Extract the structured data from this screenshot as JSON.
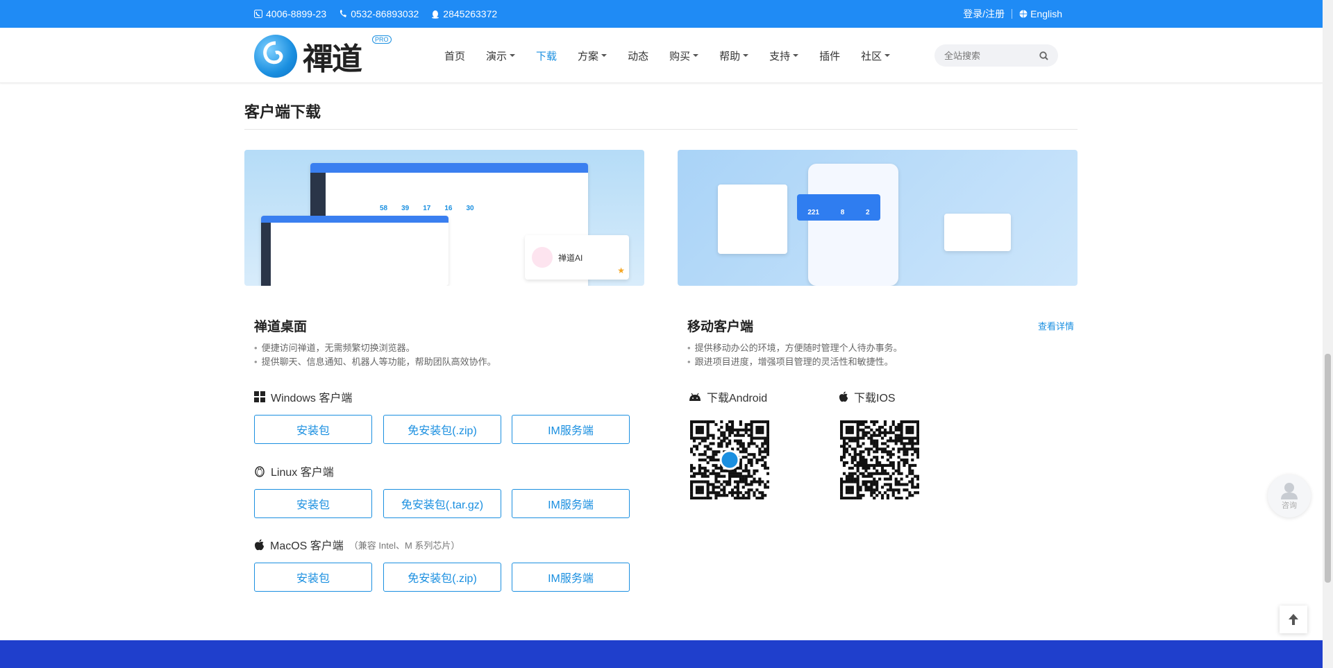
{
  "topbar": {
    "hotline": "4006-8899-23",
    "phone": "0532-86893032",
    "qq": "2845263372",
    "login": "登录/注册",
    "language": "English"
  },
  "brand": {
    "name": "禪道",
    "badge": "PRO"
  },
  "nav": {
    "items": [
      {
        "label": "首页",
        "dropdown": false,
        "active": false
      },
      {
        "label": "演示",
        "dropdown": true,
        "active": false
      },
      {
        "label": "下载",
        "dropdown": false,
        "active": true
      },
      {
        "label": "方案",
        "dropdown": true,
        "active": false
      },
      {
        "label": "动态",
        "dropdown": false,
        "active": false
      },
      {
        "label": "购买",
        "dropdown": true,
        "active": false
      },
      {
        "label": "帮助",
        "dropdown": true,
        "active": false
      },
      {
        "label": "支持",
        "dropdown": true,
        "active": false
      },
      {
        "label": "插件",
        "dropdown": false,
        "active": false
      },
      {
        "label": "社区",
        "dropdown": true,
        "active": false
      }
    ],
    "search_placeholder": "全站搜索"
  },
  "section": {
    "title": "客户端下载"
  },
  "banner_left": {
    "ai_label": "禅道AI",
    "stats": [
      "58",
      "39",
      "17",
      "16",
      "30"
    ]
  },
  "banner_right": {
    "stats": [
      "221",
      "8",
      "2"
    ]
  },
  "desktop": {
    "title": "禅道桌面",
    "bullets": [
      "便捷访问禅道，无需频繁切换浏览器。",
      "提供聊天、信息通知、机器人等功能，帮助团队高效协作。"
    ],
    "windows": {
      "label": "Windows 客户端",
      "buttons": [
        "安装包",
        "免安装包(.zip)",
        "IM服务端"
      ]
    },
    "linux": {
      "label": "Linux 客户端",
      "buttons": [
        "安装包",
        "免安装包(.tar.gz)",
        "IM服务端"
      ]
    },
    "macos": {
      "label": "MacOS 客户端",
      "note": "（兼容 Intel、M 系列芯片）",
      "buttons": [
        "安装包",
        "免安装包(.zip)",
        "IM服务端"
      ]
    }
  },
  "mobile": {
    "title": "移动客户端",
    "more": "查看详情",
    "bullets": [
      "提供移动办公的环境，方便随时管理个人待办事务。",
      "跟进项目进度，增强项目管理的灵活性和敏捷性。"
    ],
    "android_label": "下载Android",
    "ios_label": "下载IOS"
  },
  "float": {
    "consult": "咨询"
  },
  "colors": {
    "brand_blue": "#1f8bf5",
    "link_blue": "#1a8fe0",
    "footer": "#1f3fcc"
  }
}
